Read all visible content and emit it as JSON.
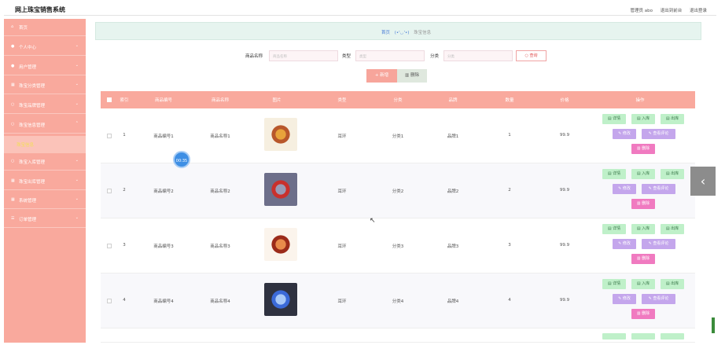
{
  "app": {
    "title": "网上珠宝销售系统"
  },
  "topbar": {
    "admin_text": "管理员 abo",
    "back_link": "退出到前台",
    "logout_link": "退出登录"
  },
  "sidebar": {
    "items": [
      {
        "label": "首页",
        "icon": "home-icon",
        "has_chevron": false
      },
      {
        "label": "个人中心",
        "icon": "user-icon",
        "has_chevron": true
      },
      {
        "label": "用户管理",
        "icon": "users-icon",
        "has_chevron": true
      },
      {
        "label": "珠宝分类管理",
        "icon": "grid-icon",
        "has_chevron": true
      },
      {
        "label": "珠宝品牌管理",
        "icon": "circle-icon",
        "has_chevron": true
      },
      {
        "label": "珠宝信息管理",
        "icon": "circle-icon",
        "has_chevron": true
      },
      {
        "label": "珠宝入库管理",
        "icon": "circle-icon",
        "has_chevron": true
      },
      {
        "label": "珠宝出库管理",
        "icon": "grid-icon",
        "has_chevron": true
      },
      {
        "label": "系统管理",
        "icon": "grid-icon",
        "has_chevron": true
      },
      {
        "label": "订单管理",
        "icon": "list-icon",
        "has_chevron": true
      }
    ],
    "active_sub": "珠宝信息"
  },
  "breadcrumb": {
    "home": "首页",
    "face": "(•'◡'•)",
    "current": "珠宝信息"
  },
  "search": {
    "name_label": "商品名称",
    "name_placeholder": "商品名称",
    "type_label": "类型",
    "type_placeholder": "类型",
    "category_label": "分类",
    "category_placeholder": "分类",
    "query_button": "查询"
  },
  "actions": {
    "add": "新增",
    "delete": "删除"
  },
  "table": {
    "headers": [
      "索引",
      "商品编号",
      "商品名称",
      "图片",
      "类型",
      "分类",
      "品牌",
      "数量",
      "价格",
      "操作"
    ],
    "rows": [
      {
        "index": "1",
        "code": "商品编号1",
        "name": "商品名称1",
        "type": "耳环",
        "category": "分类1",
        "brand": "品牌1",
        "qty": "1",
        "price": "99.9"
      },
      {
        "index": "2",
        "code": "商品编号2",
        "name": "商品名称2",
        "type": "耳环",
        "category": "分类2",
        "brand": "品牌2",
        "qty": "2",
        "price": "99.9"
      },
      {
        "index": "3",
        "code": "商品编号3",
        "name": "商品名称3",
        "type": "耳环",
        "category": "分类3",
        "brand": "品牌3",
        "qty": "3",
        "price": "99.9"
      },
      {
        "index": "4",
        "code": "商品编号4",
        "name": "商品名称4",
        "type": "耳环",
        "category": "分类4",
        "brand": "品牌4",
        "qty": "4",
        "price": "99.9"
      }
    ],
    "row_actions": {
      "detail": "详情",
      "stock_in": "入库",
      "stock_out": "出库",
      "edit": "修改",
      "view_comments": "查看评论",
      "delete": "删除"
    }
  },
  "overlay": {
    "timer": "00:35"
  }
}
